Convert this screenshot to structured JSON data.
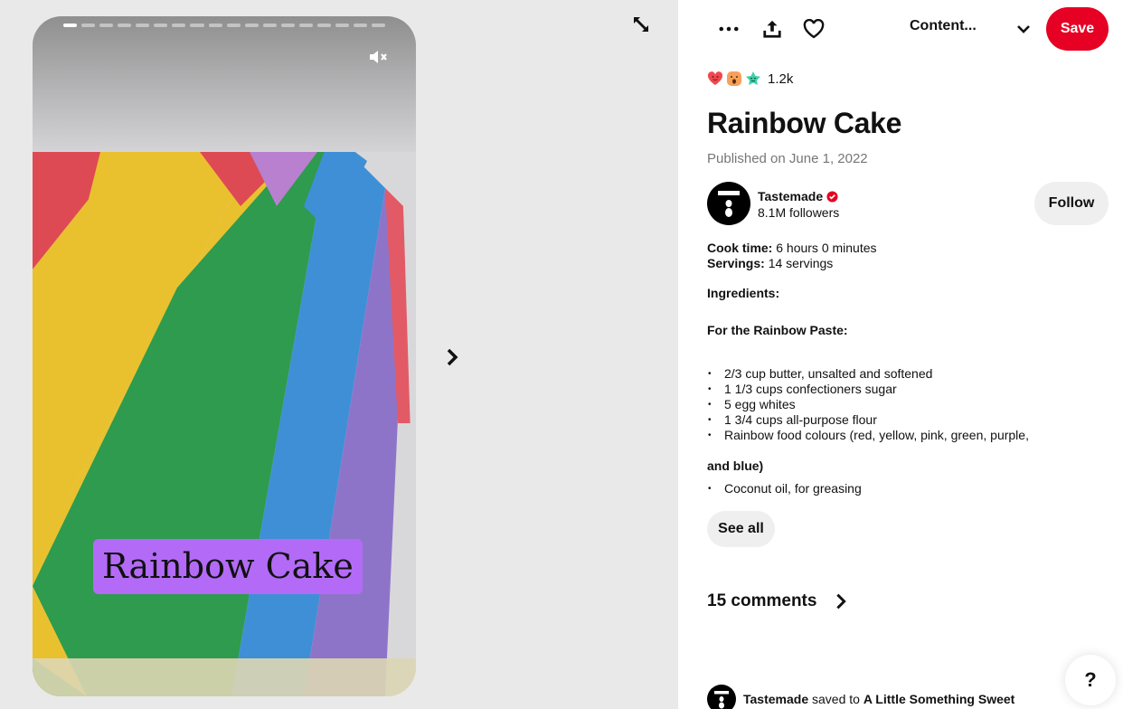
{
  "media": {
    "overlay_title": "Rainbow Cake",
    "story_pages": 18,
    "current_page": 1,
    "muted": true
  },
  "toolbar": {
    "more_icon": "ellipsis-icon",
    "share_icon": "share-icon",
    "like_icon": "heart-icon",
    "board_select_label": "Content...",
    "save_label": "Save",
    "save_color": "#e60023"
  },
  "reactions": {
    "icons": [
      "heart-face-reaction",
      "wow-reaction",
      "star-reaction"
    ],
    "count": "1.2k"
  },
  "pin": {
    "title": "Rainbow Cake",
    "published": "Published on June 1, 2022"
  },
  "creator": {
    "name": "Tastemade",
    "verified": true,
    "followers": "8.1M followers",
    "follow_label": "Follow"
  },
  "recipe": {
    "cook_time_label": "Cook time:",
    "cook_time_value": "6 hours 0 minutes",
    "servings_label": "Servings:",
    "servings_value": "14 servings",
    "ingredients_heading": "Ingredients:",
    "section_heading": "For the Rainbow Paste:",
    "items": [
      "2/3 cup butter, unsalted and softened",
      "1 1/3 cups confectioners sugar",
      "5 egg whites",
      "1 3/4 cups all-purpose flour",
      "Rainbow food colours (red, yellow, pink, green, purple,"
    ],
    "wrapped_line": "and blue)",
    "extra_items": [
      "Coconut oil, for greasing"
    ],
    "see_all_label": "See all"
  },
  "comments": {
    "label": "15 comments"
  },
  "activity": {
    "user": "Tastemade",
    "action": "saved to",
    "board": "A Little Something Sweet"
  },
  "help": {
    "label": "?"
  }
}
